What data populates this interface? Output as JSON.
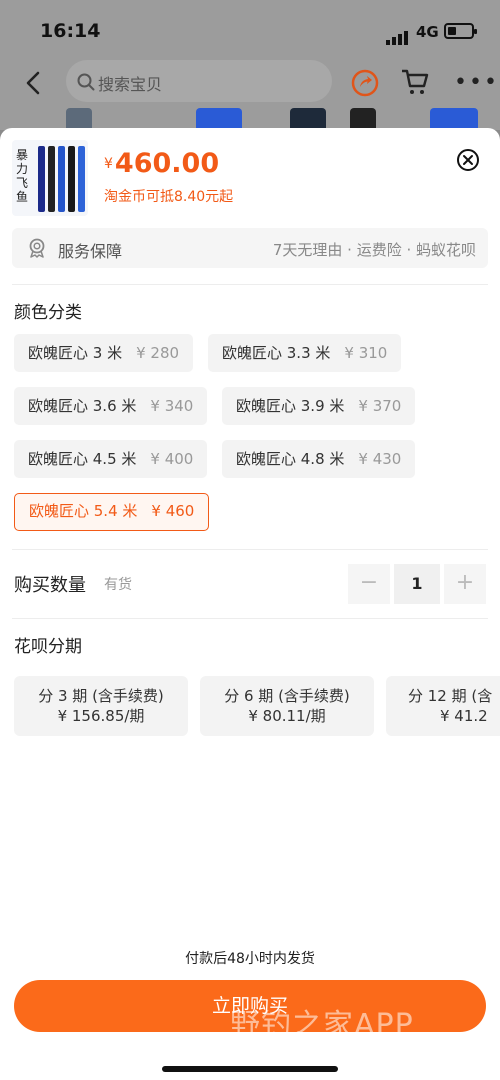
{
  "status_bar": {
    "time": "16:14",
    "network": "4G"
  },
  "nav": {
    "search_placeholder": "搜索宝贝"
  },
  "product": {
    "thumb_text": "暴力飞鱼",
    "currency": "¥",
    "price": "460.00",
    "coin_note": "淘金币可抵8.40元起"
  },
  "service": {
    "title": "服务保障",
    "desc": "7天无理由 · 运费险 · 蚂蚁花呗"
  },
  "color_section": {
    "title": "颜色分类",
    "options": [
      {
        "name": "欧魄匠心 3 米",
        "price": "¥ 280"
      },
      {
        "name": "欧魄匠心 3.3 米",
        "price": "¥ 310"
      },
      {
        "name": "欧魄匠心 3.6 米",
        "price": "¥ 340"
      },
      {
        "name": "欧魄匠心 3.9 米",
        "price": "¥ 370"
      },
      {
        "name": "欧魄匠心 4.5 米",
        "price": "¥ 400"
      },
      {
        "name": "欧魄匠心 4.8 米",
        "price": "¥ 430"
      },
      {
        "name": "欧魄匠心 5.4 米",
        "price": "¥ 460"
      }
    ],
    "selected": 6
  },
  "quantity": {
    "label": "购买数量",
    "stock": "有货",
    "minus": "−",
    "value": "1",
    "plus": "+"
  },
  "installment": {
    "title": "花呗分期",
    "plans": [
      {
        "term": "分 3 期 (含手续费)",
        "amount": "¥ 156.85/期"
      },
      {
        "term": "分 6 期 (含手续费)",
        "amount": "¥ 80.11/期"
      },
      {
        "term": "分 12 期 (含",
        "amount": "¥ 41.2"
      }
    ]
  },
  "footer": {
    "ship_note": "付款后48小时内发货",
    "buy_label": "立即购买",
    "watermark": "野钓之家APP"
  },
  "colors": {
    "accent": "#f25a17",
    "button": "#fb6a1a"
  }
}
